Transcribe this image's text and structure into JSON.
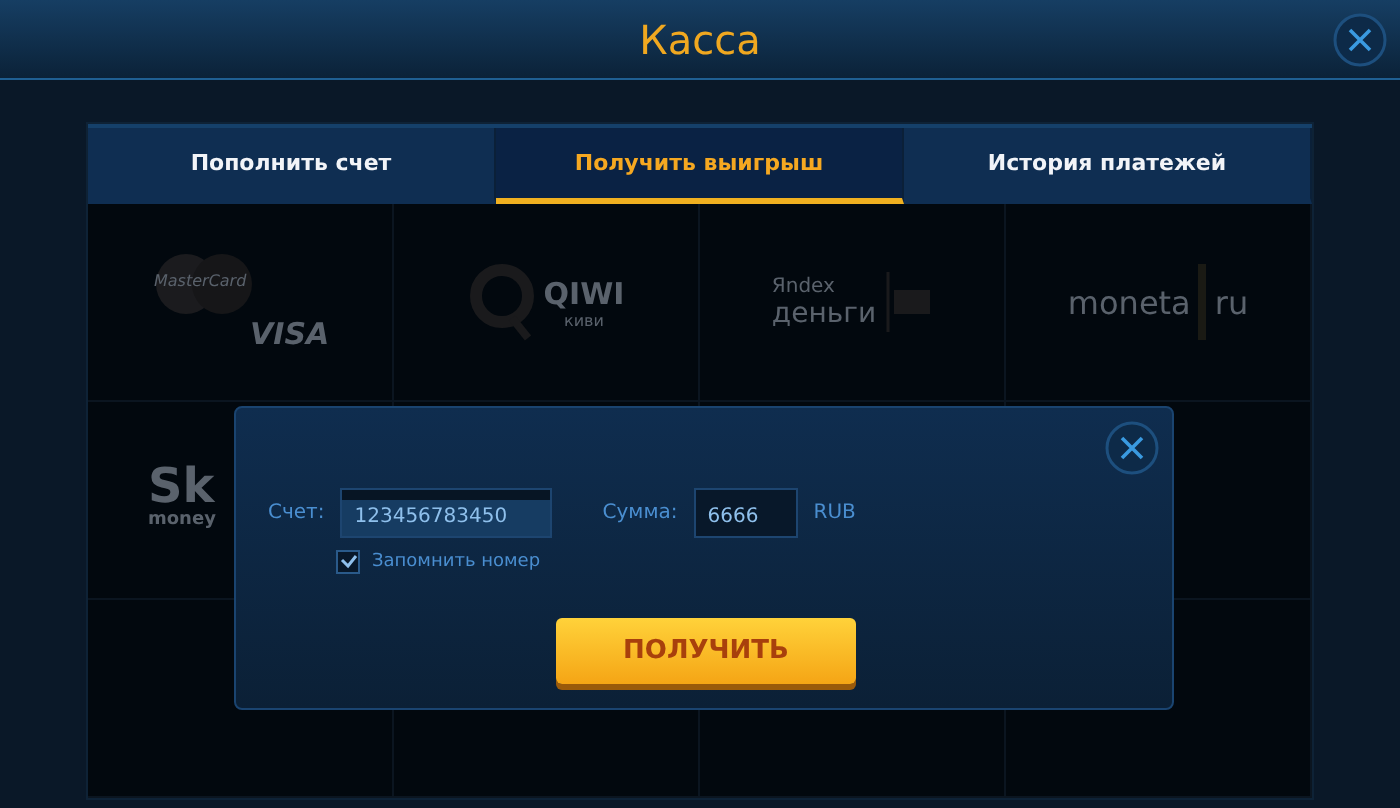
{
  "window": {
    "title": "Касса"
  },
  "tabs": [
    {
      "label": "Пополнить счет",
      "selected": false
    },
    {
      "label": "Получить выигрыш",
      "selected": true
    },
    {
      "label": "История платежей",
      "selected": false
    }
  ],
  "payment_methods": [
    {
      "kind": "cards",
      "texts": [
        "MasterCard",
        "VISA"
      ]
    },
    {
      "kind": "qiwi",
      "texts": [
        "QIWI",
        "киви"
      ]
    },
    {
      "kind": "yandex",
      "texts": [
        "Яndex",
        "деньги"
      ]
    },
    {
      "kind": "moneta",
      "texts": [
        "moneta",
        "ru"
      ]
    },
    {
      "kind": "skrill",
      "texts": [
        "Sk",
        "money"
      ]
    }
  ],
  "dialog": {
    "account_label": "Счет:",
    "account_value": "123456783450",
    "amount_label": "Сумма:",
    "amount_value": "6666",
    "currency": "RUB",
    "remember": {
      "label": "Запомнить номер",
      "checked": true
    },
    "submit": "ПОЛУЧИТЬ"
  }
}
